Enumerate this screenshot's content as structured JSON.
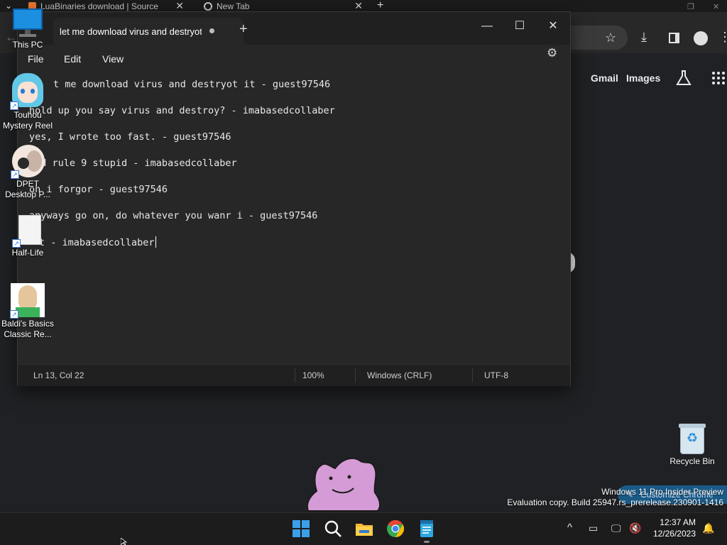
{
  "chrome": {
    "tabs": [
      {
        "title": "LuaBinaries download | Source",
        "close": "✕"
      },
      {
        "title": "New Tab",
        "close": "✕"
      }
    ],
    "new_tab": "+",
    "links": {
      "gmail": "Gmail",
      "images": "Images"
    },
    "customize_label": "Customize Chrome"
  },
  "notepad": {
    "tab_title": "let me download virus and destryot it",
    "new_tab": "+",
    "window_controls": {
      "minimize": "—",
      "maximize": "☐",
      "close": "✕"
    },
    "menu": [
      "File",
      "Edit",
      "View"
    ],
    "lines": [
      "t me download virus and destryot it - guest97546",
      "hold up you say virus and destroy? - imabasedcollaber",
      "yes, I wrote too fast. - guest97546",
      "ead rule 9 stupid - imabasedcollaber",
      "oh i forgor - guest97546",
      "anyways go on, do whatever you wanr i - guest97546",
      "t - imabasedcollaber"
    ],
    "status": {
      "position": "Ln 13, Col 22",
      "zoom": "100%",
      "line_ending": "Windows (CRLF)",
      "encoding": "UTF-8"
    }
  },
  "desktop": {
    "icons": [
      {
        "label": "This PC"
      },
      {
        "label": "Touhou Mystery Reel"
      },
      {
        "label": "DPET Desktop P..."
      },
      {
        "label": "Half-Life"
      },
      {
        "label": "Baldi's Basics Classic Re..."
      },
      {
        "label": "Recycle Bin"
      }
    ],
    "watermark": {
      "line1": "Windows 11 Pro Insider Preview",
      "line2": "Evaluation copy. Build 25947.rs_prerelease.230901-1416"
    }
  },
  "taskbar": {
    "apps": [
      "start-button",
      "search",
      "file-explorer",
      "chrome",
      "notepad"
    ],
    "time": "12:37 AM",
    "date": "12/26/2023",
    "tray_overflow": "^"
  },
  "colors": {
    "notepad_bg": "#272727",
    "taskbar_bg": "#1c1c1c",
    "chrome_page_bg": "#202124",
    "windows_blue": "#0f7fd8"
  }
}
